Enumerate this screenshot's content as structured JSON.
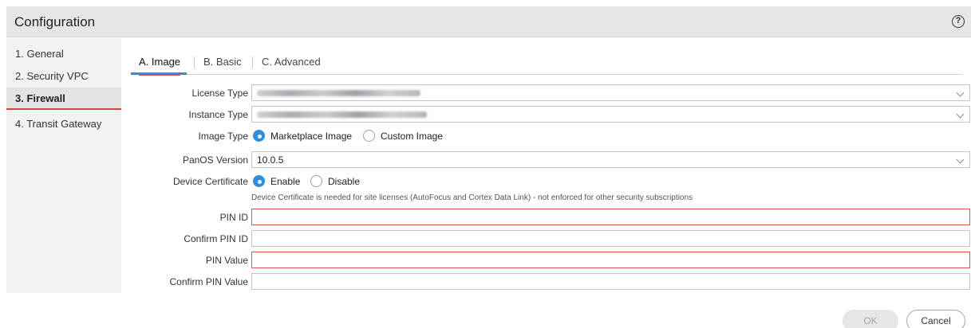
{
  "header": {
    "title": "Configuration",
    "help_icon": "?"
  },
  "sidebar": {
    "items": [
      {
        "label": "1. General"
      },
      {
        "label": "2. Security VPC"
      },
      {
        "label": "3. Firewall"
      },
      {
        "label": "4. Transit Gateway"
      }
    ],
    "active_index": 2
  },
  "tabs": [
    {
      "label": "A. Image"
    },
    {
      "label": "B. Basic"
    },
    {
      "label": "C. Advanced"
    }
  ],
  "form": {
    "license_type": {
      "label": "License Type",
      "value": ""
    },
    "instance_type": {
      "label": "Instance Type",
      "value": ""
    },
    "image_type": {
      "label": "Image Type",
      "options": [
        "Marketplace Image",
        "Custom Image"
      ],
      "selected": "Marketplace Image"
    },
    "panos_version": {
      "label": "PanOS Version",
      "value": "10.0.5"
    },
    "device_certificate": {
      "label": "Device Certificate",
      "options": [
        "Enable",
        "Disable"
      ],
      "selected": "Enable",
      "hint": "Device Certificate is needed for site licenses (AutoFocus and Cortex Data Link) - not enforced for other security subscriptions"
    },
    "pin_id": {
      "label": "PIN ID",
      "value": ""
    },
    "confirm_pin_id": {
      "label": "Confirm PIN ID",
      "value": ""
    },
    "pin_value": {
      "label": "PIN Value",
      "value": ""
    },
    "confirm_pin_value": {
      "label": "Confirm PIN Value",
      "value": ""
    }
  },
  "footer": {
    "ok_label": "OK",
    "cancel_label": "Cancel"
  },
  "colors": {
    "accent_blue": "#2d8fe0",
    "error_red": "#d9534f",
    "active_underline": "#d04545"
  }
}
